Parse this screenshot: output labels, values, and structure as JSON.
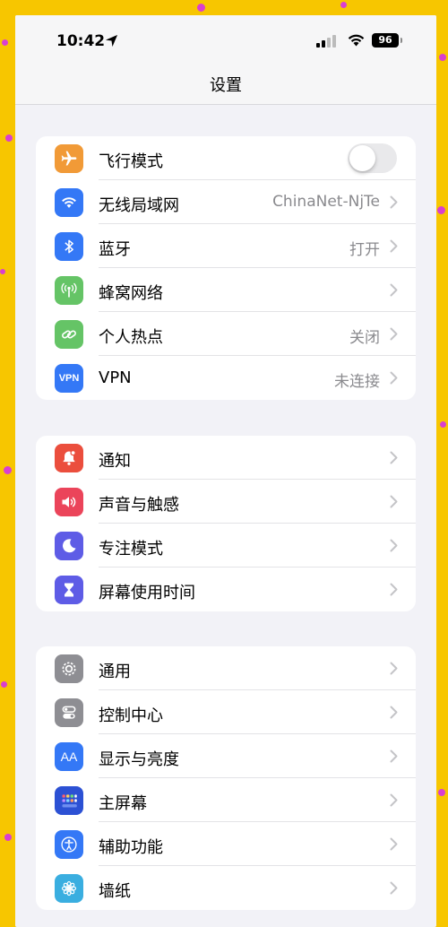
{
  "status_bar": {
    "time": "10:42",
    "battery": "96"
  },
  "header": {
    "title": "设置"
  },
  "colors": {
    "airplane": "#f19a37",
    "wifi": "#3478f6",
    "bluetooth": "#3478f6",
    "cellular": "#65c466",
    "hotspot": "#65c466",
    "vpn": "#3478f6",
    "notifications": "#eb4e3d",
    "sounds": "#eb445a",
    "focus": "#5e5ce6",
    "screen_time": "#5e5ce6",
    "general": "#8e8e93",
    "control_center": "#8e8e93",
    "display": "#3478f6",
    "home_screen": "#2c51d4",
    "accessibility": "#3478f6",
    "wallpaper": "#3aaee0"
  },
  "groups": [
    {
      "items": [
        {
          "icon": "airplane-icon",
          "label": "飞行模式",
          "toggle": "off"
        },
        {
          "icon": "wifi-icon",
          "label": "无线局域网",
          "value": "ChinaNet-NjTe"
        },
        {
          "icon": "bluetooth-icon",
          "label": "蓝牙",
          "value": "打开"
        },
        {
          "icon": "cellular-antenna-icon",
          "label": "蜂窝网络"
        },
        {
          "icon": "hotspot-link-icon",
          "label": "个人热点",
          "value": "关闭"
        },
        {
          "icon": "vpn-icon",
          "label": "VPN",
          "icon_text": "VPN",
          "value": "未连接"
        }
      ]
    },
    {
      "items": [
        {
          "icon": "bell-icon",
          "label": "通知"
        },
        {
          "icon": "speaker-icon",
          "label": "声音与触感"
        },
        {
          "icon": "moon-icon",
          "label": "专注模式"
        },
        {
          "icon": "hourglass-icon",
          "label": "屏幕使用时间"
        }
      ]
    },
    {
      "items": [
        {
          "icon": "gear-icon",
          "label": "通用"
        },
        {
          "icon": "switches-icon",
          "label": "控制中心"
        },
        {
          "icon": "text-size-icon",
          "label": "显示与亮度",
          "icon_text": "AA"
        },
        {
          "icon": "app-grid-icon",
          "label": "主屏幕"
        },
        {
          "icon": "accessibility-icon",
          "label": "辅助功能"
        },
        {
          "icon": "flower-icon",
          "label": "墙纸"
        }
      ]
    }
  ]
}
